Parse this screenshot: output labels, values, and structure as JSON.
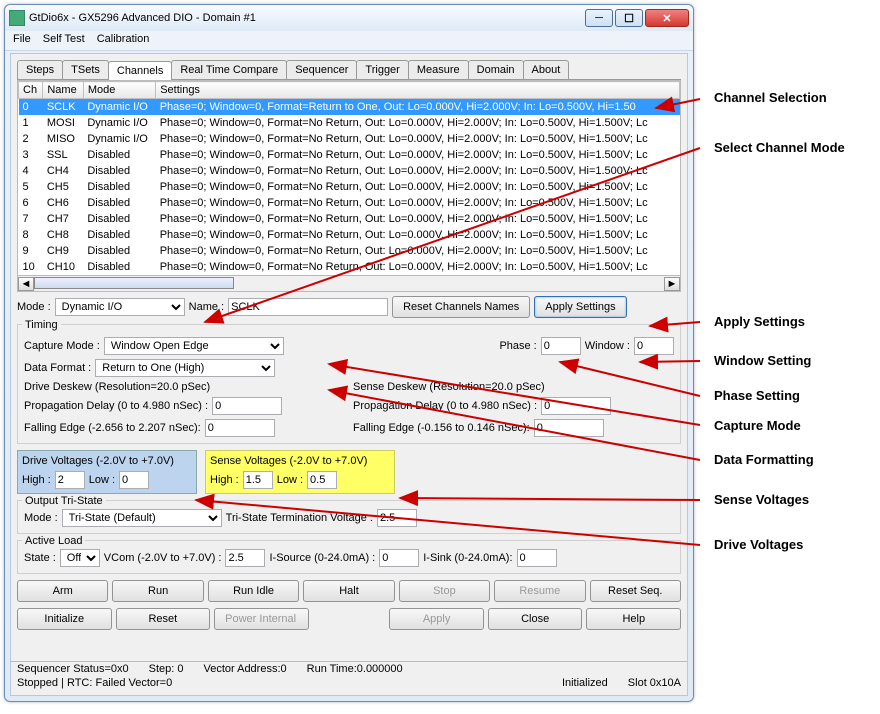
{
  "window": {
    "title": "GtDio6x - GX5296 Advanced DIO - Domain #1"
  },
  "menu": [
    "File",
    "Self Test",
    "Calibration"
  ],
  "tabs": [
    "Steps",
    "TSets",
    "Channels",
    "Real Time Compare",
    "Sequencer",
    "Trigger",
    "Measure",
    "Domain",
    "About"
  ],
  "selectedTab": 2,
  "table": {
    "headers": [
      "Ch",
      "Name",
      "Mode",
      "Settings"
    ],
    "rows": [
      {
        "ch": "0",
        "name": "SCLK",
        "mode": "Dynamic I/O",
        "settings": "Phase=0; Window=0, Format=Return to One, Out: Lo=0.000V, Hi=2.000V; In: Lo=0.500V, Hi=1.50",
        "sel": true
      },
      {
        "ch": "1",
        "name": "MOSI",
        "mode": "Dynamic I/O",
        "settings": "Phase=0; Window=0, Format=No Return, Out: Lo=0.000V, Hi=2.000V; In: Lo=0.500V, Hi=1.500V; Lc"
      },
      {
        "ch": "2",
        "name": "MISO",
        "mode": "Dynamic I/O",
        "settings": "Phase=0; Window=0, Format=No Return, Out: Lo=0.000V, Hi=2.000V; In: Lo=0.500V, Hi=1.500V; Lc"
      },
      {
        "ch": "3",
        "name": "SSL",
        "mode": "Disabled",
        "settings": "Phase=0; Window=0, Format=No Return, Out: Lo=0.000V, Hi=2.000V; In: Lo=0.500V, Hi=1.500V; Lc"
      },
      {
        "ch": "4",
        "name": "CH4",
        "mode": "Disabled",
        "settings": "Phase=0; Window=0, Format=No Return, Out: Lo=0.000V, Hi=2.000V; In: Lo=0.500V, Hi=1.500V; Lc"
      },
      {
        "ch": "5",
        "name": "CH5",
        "mode": "Disabled",
        "settings": "Phase=0; Window=0, Format=No Return, Out: Lo=0.000V, Hi=2.000V; In: Lo=0.500V, Hi=1.500V; Lc"
      },
      {
        "ch": "6",
        "name": "CH6",
        "mode": "Disabled",
        "settings": "Phase=0; Window=0, Format=No Return, Out: Lo=0.000V, Hi=2.000V; In: Lo=0.500V, Hi=1.500V; Lc"
      },
      {
        "ch": "7",
        "name": "CH7",
        "mode": "Disabled",
        "settings": "Phase=0; Window=0, Format=No Return, Out: Lo=0.000V, Hi=2.000V; In: Lo=0.500V, Hi=1.500V; Lc"
      },
      {
        "ch": "8",
        "name": "CH8",
        "mode": "Disabled",
        "settings": "Phase=0; Window=0, Format=No Return, Out: Lo=0.000V, Hi=2.000V; In: Lo=0.500V, Hi=1.500V; Lc"
      },
      {
        "ch": "9",
        "name": "CH9",
        "mode": "Disabled",
        "settings": "Phase=0; Window=0, Format=No Return, Out: Lo=0.000V, Hi=2.000V; In: Lo=0.500V, Hi=1.500V; Lc"
      },
      {
        "ch": "10",
        "name": "CH10",
        "mode": "Disabled",
        "settings": "Phase=0; Window=0, Format=No Return, Out: Lo=0.000V, Hi=2.000V; In: Lo=0.500V, Hi=1.500V; Lc"
      }
    ]
  },
  "mode": {
    "label": "Mode :",
    "value": "Dynamic I/O"
  },
  "name": {
    "label": "Name :",
    "value": "SCLK"
  },
  "resetNames": "Reset Channels Names",
  "apply": "Apply Settings",
  "timing": {
    "title": "Timing",
    "captureLabel": "Capture Mode :",
    "capture": "Window Open Edge",
    "dataFmtLabel": "Data Format :",
    "dataFmt": "Return to One (High)",
    "phaseLabel": "Phase :",
    "phase": "0",
    "windowLabel": "Window :",
    "window": "0",
    "driveDeskew": "Drive Deskew (Resolution=20.0 pSec)",
    "senseDeskew": "Sense Deskew (Resolution=20.0 pSec)",
    "propLabel": "Propagation Delay (0 to 4.980 nSec) :",
    "prop": "0",
    "fallDLabel": "Falling Edge (-2.656 to 2.207 nSec):",
    "fallD": "0",
    "fallSLabel": "Falling Edge (-0.156 to 0.146 nSec):",
    "fallS": "0"
  },
  "driveV": {
    "title": "Drive Voltages (-2.0V to +7.0V)",
    "highL": "High :",
    "high": "2",
    "lowL": "Low :",
    "low": "0"
  },
  "senseV": {
    "title": "Sense Voltages (-2.0V to +7.0V)",
    "highL": "High :",
    "high": "1.5",
    "lowL": "Low :",
    "low": "0.5"
  },
  "tristate": {
    "title": "Output Tri-State",
    "modeL": "Mode :",
    "mode": "Tri-State (Default)",
    "termL": "Tri-State Termination Voltage :",
    "term": "2.5"
  },
  "activeLoad": {
    "title": "Active Load",
    "stateL": "State :",
    "state": "Off",
    "vcomL": "VCom (-2.0V to +7.0V) :",
    "vcom": "2.5",
    "isrcL": "I-Source (0-24.0mA) :",
    "isrc": "0",
    "isinkL": "I-Sink (0-24.0mA):",
    "isink": "0"
  },
  "buttons1": [
    "Arm",
    "Run",
    "Run Idle",
    "Halt",
    "Stop",
    "Resume",
    "Reset Seq."
  ],
  "buttons2": [
    "Initialize",
    "Reset",
    "Power Internal",
    "",
    "Apply",
    "Close",
    "Help"
  ],
  "status1": {
    "a": "Sequencer Status=0x0",
    "b": "Step: 0",
    "c": "Vector Address:0",
    "d": "Run Time:0.000000"
  },
  "status2": {
    "a": "Stopped | RTC: Failed Vector=0",
    "b": "Initialized",
    "c": "Slot 0x10A"
  },
  "ann": {
    "chSel": "Channel Selection",
    "chMode": "Select Channel Mode",
    "apply": "Apply Settings",
    "window": "Window Setting",
    "phase": "Phase Setting",
    "capture": "Capture Mode",
    "dataFmt": "Data Formatting",
    "senseV": "Sense Voltages",
    "driveV": "Drive Voltages"
  }
}
